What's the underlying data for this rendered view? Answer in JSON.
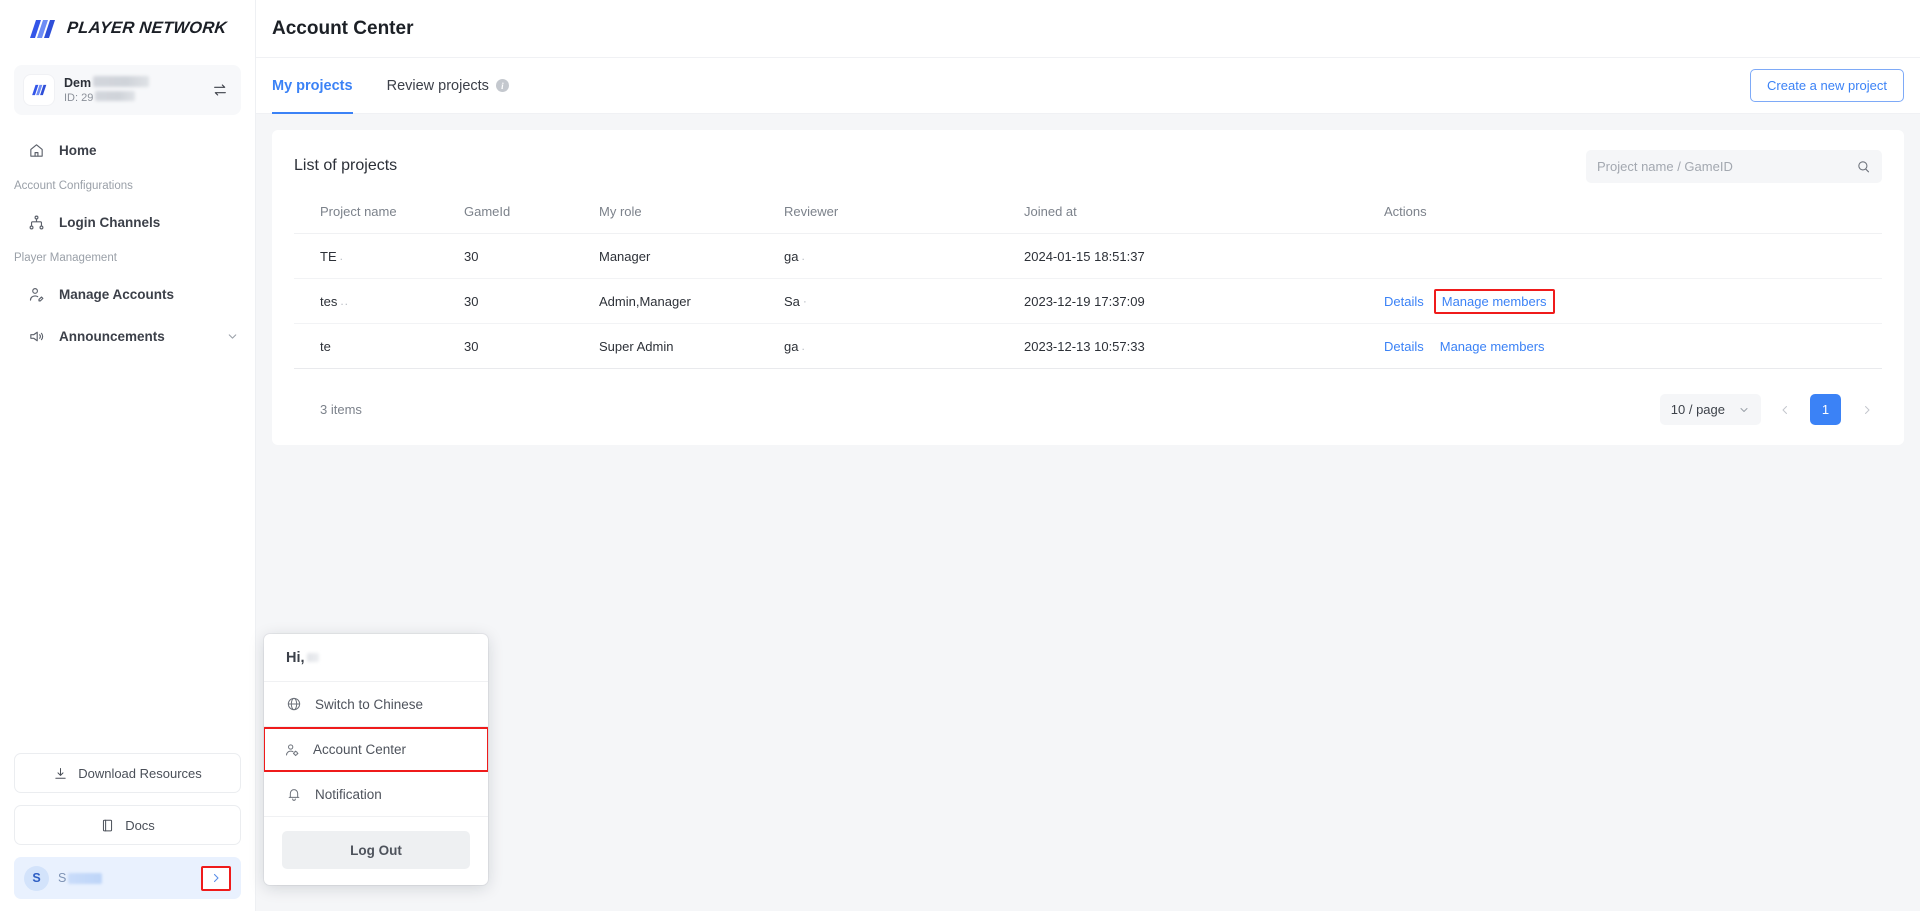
{
  "brand": {
    "name": "PLAYER NETWORK",
    "accent": "#3b82f6",
    "logo_icon": "player-network-logo-icon"
  },
  "account_card": {
    "name_prefix": "Dem",
    "id_label": "ID: 29",
    "switch_icon": "switch-account-icon"
  },
  "sidebar": {
    "items": [
      {
        "label": "Home",
        "icon": "home-icon"
      }
    ],
    "groups": [
      {
        "title": "Account Configurations",
        "items": [
          {
            "label": "Login Channels",
            "icon": "sitemap-icon"
          }
        ]
      },
      {
        "title": "Player Management",
        "items": [
          {
            "label": "Manage Accounts",
            "icon": "user-edit-icon"
          },
          {
            "label": "Announcements",
            "icon": "megaphone-icon",
            "caret": "chevron-down-icon"
          }
        ]
      }
    ],
    "bottom": {
      "download_label": "Download Resources",
      "download_icon": "download-icon",
      "docs_label": "Docs",
      "docs_icon": "book-icon",
      "user_initial": "S",
      "user_arrow_icon": "chevron-right-icon"
    }
  },
  "header": {
    "title": "Account Center"
  },
  "tabs": [
    {
      "label": "My projects",
      "active": true
    },
    {
      "label": "Review projects",
      "active": false,
      "info_icon": "info-circle-icon",
      "info_glyph": "i"
    }
  ],
  "actions": {
    "create_project_label": "Create a new project"
  },
  "panel": {
    "title": "List of projects",
    "search": {
      "placeholder": "Project name / GameID",
      "value": "",
      "icon": "search-icon"
    }
  },
  "table": {
    "columns": [
      "Project name",
      "GameId",
      "My role",
      "Reviewer",
      "Joined at",
      "Actions"
    ],
    "rows": [
      {
        "project_name": "TE",
        "game_id": "30",
        "my_role": "Manager",
        "reviewer": "ga",
        "joined_at": "2024-01-15 18:51:37",
        "actions": []
      },
      {
        "project_name": "tes",
        "game_id": "30",
        "my_role": "Admin,Manager",
        "reviewer": "Sa",
        "joined_at": "2023-12-19 17:37:09",
        "actions": [
          "Details",
          "Manage members"
        ],
        "highlight_action": "Manage members"
      },
      {
        "project_name": "te",
        "game_id": "30",
        "my_role": "Super Admin",
        "reviewer": "ga",
        "joined_at": "2023-12-13 10:57:33",
        "actions": [
          "Details",
          "Manage members"
        ]
      }
    ]
  },
  "pagination": {
    "items_text": "3 items",
    "page_size": "10 / page",
    "page_size_caret": "chevron-down-icon",
    "prev_icon": "chevron-left-icon",
    "next_icon": "chevron-right-icon",
    "current_page": "1"
  },
  "popup_menu": {
    "greeting": "Hi,",
    "items": [
      {
        "label": "Switch to Chinese",
        "icon": "globe-icon",
        "highlighted": false
      },
      {
        "label": "Account Center",
        "icon": "user-gear-icon",
        "highlighted": true
      },
      {
        "label": "Notification",
        "icon": "bell-icon",
        "highlighted": false
      }
    ],
    "logout_label": "Log Out"
  },
  "highlight_color": "#ef1b1b"
}
